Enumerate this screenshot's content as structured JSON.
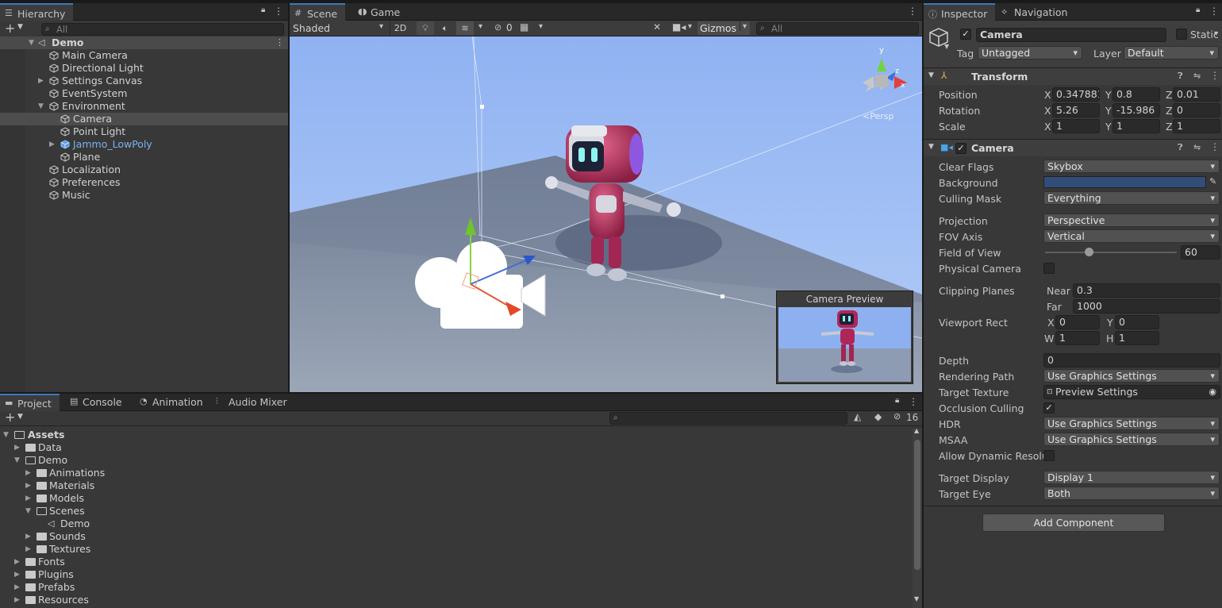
{
  "hierarchy": {
    "tab": "Hierarchy",
    "search_placeholder": "All",
    "scene_name": "Demo",
    "items": [
      {
        "label": "Main Camera"
      },
      {
        "label": "Directional Light"
      },
      {
        "label": "Settings Canvas"
      },
      {
        "label": "EventSystem"
      },
      {
        "label": "Environment"
      },
      {
        "label": "Camera"
      },
      {
        "label": "Point Light"
      },
      {
        "label": "Jammo_LowPoly"
      },
      {
        "label": "Plane"
      },
      {
        "label": "Localization"
      },
      {
        "label": "Preferences"
      },
      {
        "label": "Music"
      }
    ]
  },
  "scene_view": {
    "tabs": [
      "Scene",
      "Game"
    ],
    "shading_mode": "Shaded",
    "btn_2d": "2D",
    "hidden_count": "0",
    "gizmos_label": "Gizmos",
    "search_placeholder": "All",
    "persp_label": "<Persp",
    "camera_preview_title": "Camera Preview"
  },
  "inspector": {
    "tabs": [
      "Inspector",
      "Navigation"
    ],
    "object_name": "Camera",
    "static_label": "Static",
    "tag_label": "Tag",
    "tag_value": "Untagged",
    "layer_label": "Layer",
    "layer_value": "Default",
    "transform": {
      "title": "Transform",
      "position_label": "Position",
      "rotation_label": "Rotation",
      "scale_label": "Scale",
      "position": {
        "x": "0.347881",
        "y": "0.8",
        "z": "0.01"
      },
      "rotation": {
        "x": "5.26",
        "y": "-15.986",
        "z": "0"
      },
      "scale": {
        "x": "1",
        "y": "1",
        "z": "1"
      }
    },
    "camera": {
      "title": "Camera",
      "clear_flags_label": "Clear Flags",
      "clear_flags": "Skybox",
      "background_label": "Background",
      "background_color": "#314d79",
      "culling_mask_label": "Culling Mask",
      "culling_mask": "Everything",
      "projection_label": "Projection",
      "projection": "Perspective",
      "fov_axis_label": "FOV Axis",
      "fov_axis": "Vertical",
      "fov_label": "Field of View",
      "fov": "60",
      "fov_slider_fraction": 0.33,
      "physical_camera_label": "Physical Camera",
      "clipping_label": "Clipping Planes",
      "near_label": "Near",
      "near": "0.3",
      "far_label": "Far",
      "far": "1000",
      "viewport_label": "Viewport Rect",
      "vp_x": "0",
      "vp_y": "0",
      "vp_w": "1",
      "vp_h": "1",
      "depth_label": "Depth",
      "depth": "0",
      "rendering_path_label": "Rendering Path",
      "rendering_path": "Use Graphics Settings",
      "target_texture_label": "Target Texture",
      "target_texture": "Preview Settings",
      "occlusion_label": "Occlusion Culling",
      "hdr_label": "HDR",
      "hdr": "Use Graphics Settings",
      "msaa_label": "MSAA",
      "msaa": "Use Graphics Settings",
      "dyn_res_label": "Allow Dynamic Resolut",
      "target_display_label": "Target Display",
      "target_display": "Display 1",
      "target_eye_label": "Target Eye",
      "target_eye": "Both"
    },
    "add_component": "Add Component"
  },
  "project": {
    "tabs": [
      "Project",
      "Console",
      "Animation",
      "Audio Mixer"
    ],
    "hidden_count": "16",
    "tree": [
      {
        "label": "Assets"
      },
      {
        "label": "Data"
      },
      {
        "label": "Demo"
      },
      {
        "label": "Animations"
      },
      {
        "label": "Materials"
      },
      {
        "label": "Models"
      },
      {
        "label": "Scenes"
      },
      {
        "label": "Demo"
      },
      {
        "label": "Sounds"
      },
      {
        "label": "Textures"
      },
      {
        "label": "Fonts"
      },
      {
        "label": "Plugins"
      },
      {
        "label": "Prefabs"
      },
      {
        "label": "Resources"
      }
    ]
  },
  "colors": {
    "accent": "#3a79bb",
    "prefab_blue": "#7bb1ef",
    "selection": "#4d4d4d",
    "sky": "#9dbcf5"
  }
}
